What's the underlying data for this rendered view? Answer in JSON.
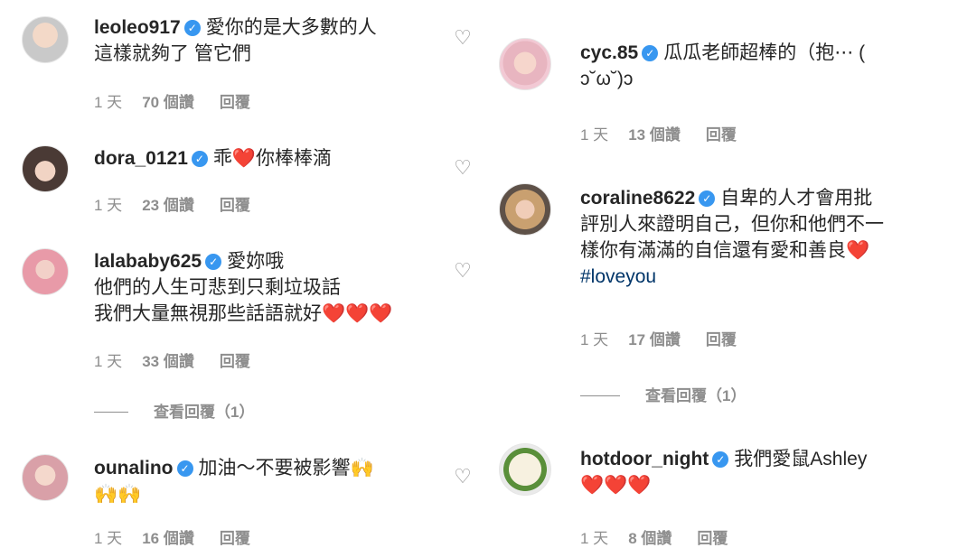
{
  "left": [
    {
      "username": "leoleo917",
      "lines": [
        "愛你的是大多數的人",
        "這樣就夠了 管它們"
      ],
      "time": "1 天",
      "likes": "70 個讚",
      "reply": "回覆"
    },
    {
      "username": "dora_0121",
      "lines": [
        "乖❤️你棒棒滴"
      ],
      "time": "1 天",
      "likes": "23 個讚",
      "reply": "回覆"
    },
    {
      "username": "lalababy625",
      "lines": [
        "愛妳哦",
        "他們的人生可悲到只剩垃圾話",
        "我們大量無視那些話語就好❤️❤️❤️"
      ],
      "time": "1 天",
      "likes": "33 個讚",
      "reply": "回覆",
      "view_replies": "查看回覆（1）"
    },
    {
      "username": "ounalino",
      "lines": [
        "加油～不要被影響🙌",
        "🙌🙌"
      ],
      "time": "1 天",
      "likes": "16 個讚",
      "reply": "回覆"
    }
  ],
  "right": [
    {
      "username": "cyc.85",
      "lines": [
        "瓜瓜老師超棒的（抱⋯ (",
        "ↄ˘ω˘)ↄ"
      ],
      "time": "1 天",
      "likes": "13 個讚",
      "reply": "回覆"
    },
    {
      "username": "coraline8622",
      "lines": [
        "自卑的人才會用批",
        "評別人來證明自己，但你和他們不一",
        "樣你有滿滿的自信還有愛和善良❤️"
      ],
      "hashtag": "#loveyou",
      "time": "1 天",
      "likes": "17 個讚",
      "reply": "回覆",
      "view_replies": "查看回覆（1）"
    },
    {
      "username": "hotdoor_night",
      "lines": [
        "我們愛鼠Ashley",
        "❤️❤️❤️"
      ],
      "time": "1 天",
      "likes": "8 個讚",
      "reply": "回覆"
    }
  ],
  "icons": {
    "verified": "verified-badge-icon",
    "like": "heart-outline-icon"
  },
  "colors": {
    "verified": "#3897f0",
    "meta": "#8e8e8e",
    "hashtag": "#003569"
  }
}
